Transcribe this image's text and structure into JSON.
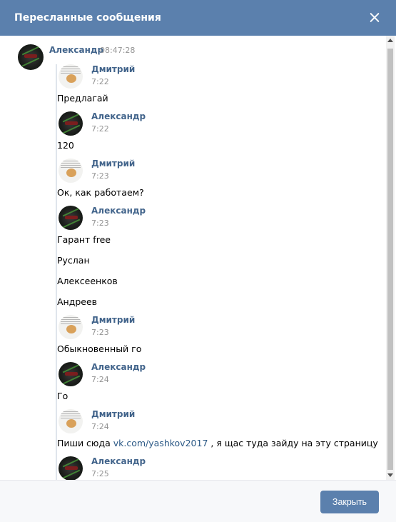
{
  "dialog": {
    "title": "Пересланные сообщения",
    "close_button_label": "Закрыть"
  },
  "outer_message": {
    "author": "Александр",
    "time": "08:47:28"
  },
  "forwarded": [
    {
      "author": "Дмитрий",
      "avatar": "dmitry",
      "time": "7:22",
      "lines": [
        "Предлагай"
      ]
    },
    {
      "author": "Александр",
      "avatar": "alexander",
      "time": "7:22",
      "lines": [
        "120"
      ]
    },
    {
      "author": "Дмитрий",
      "avatar": "dmitry",
      "time": "7:23",
      "lines": [
        "Ок, как работаем?"
      ]
    },
    {
      "author": "Александр",
      "avatar": "alexander",
      "time": "7:23",
      "lines": [
        "Гарант free",
        "Руслан",
        "Алексеенков",
        "Андреев"
      ]
    },
    {
      "author": "Дмитрий",
      "avatar": "dmitry",
      "time": "7:23",
      "lines": [
        "Обыкновенный го"
      ]
    },
    {
      "author": "Александр",
      "avatar": "alexander",
      "time": "7:24",
      "lines": [
        "Го"
      ]
    },
    {
      "author": "Дмитрий",
      "avatar": "dmitry",
      "time": "7:24",
      "text_before": "Пиши сюда ",
      "link": "vk.com/yashkov2017",
      "text_after": " , я щас туда зайду на эту страницу"
    },
    {
      "author": "Александр",
      "avatar": "alexander",
      "time": "7:25",
      "lines": []
    }
  ],
  "icons": {
    "close": "close-icon",
    "scroll_up": "scroll-up-arrow-icon",
    "scroll_down": "scroll-down-arrow-icon"
  },
  "colors": {
    "header": "#5b80ad",
    "name": "#42648b",
    "link": "#2a5885",
    "time": "#939393"
  }
}
